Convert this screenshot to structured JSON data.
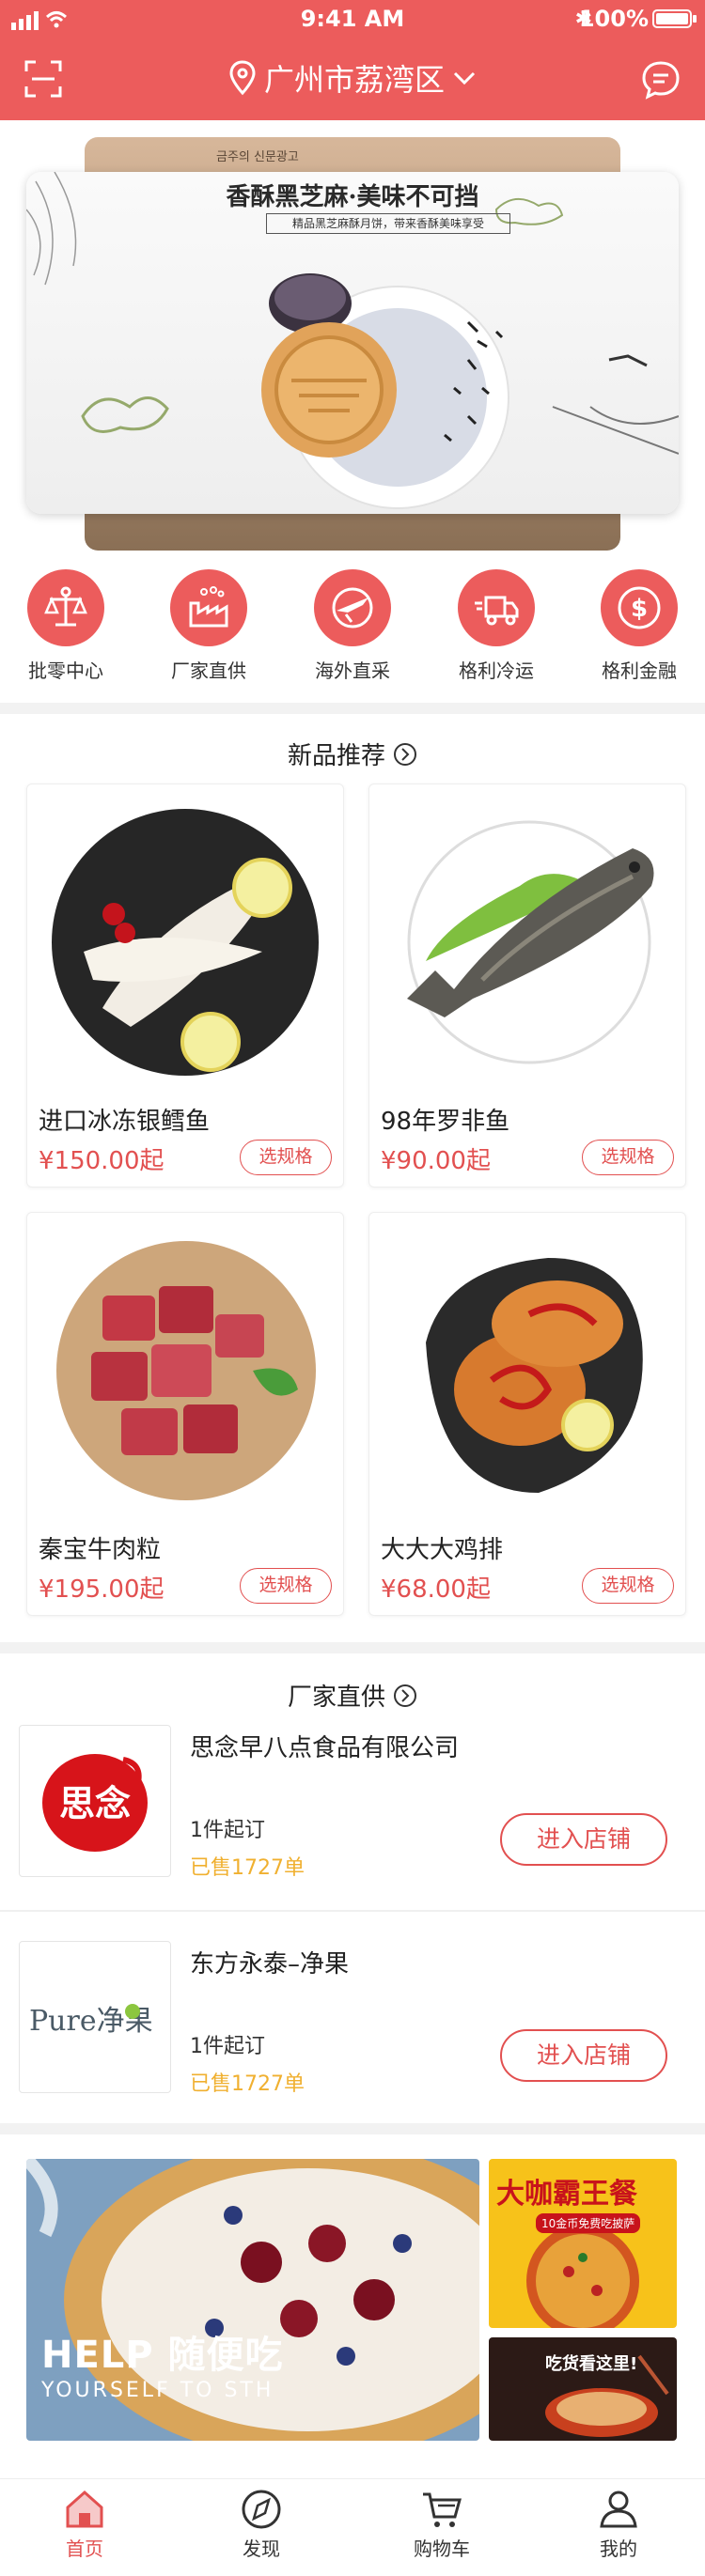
{
  "status_bar": {
    "time": "9:41 AM",
    "battery": "100%"
  },
  "header": {
    "location": "广州市荔湾区"
  },
  "banner": {
    "back_caption": "금주의 신문광고",
    "title": "香酥黑芝麻·美味不可挡",
    "subtitle": "精品黑芝麻酥月饼，带来香酥美味享受"
  },
  "categories": [
    {
      "label": "批零中心",
      "icon": "scale-icon"
    },
    {
      "label": "厂家直供",
      "icon": "factory-icon"
    },
    {
      "label": "海外直采",
      "icon": "plane-icon"
    },
    {
      "label": "格利冷运",
      "icon": "truck-icon"
    },
    {
      "label": "格利金融",
      "icon": "dollar-icon"
    }
  ],
  "new_products": {
    "title": "新品推荐",
    "spec_label": "选规格",
    "items": [
      {
        "name": "进口冰冻银鳕鱼",
        "price": "¥150.00起"
      },
      {
        "name": "98年罗非鱼",
        "price": "¥90.00起"
      },
      {
        "name": "秦宝牛肉粒",
        "price": "¥195.00起"
      },
      {
        "name": "大大大鸡排",
        "price": "¥68.00起"
      }
    ]
  },
  "factory": {
    "title": "厂家直供",
    "enter_label": "进入店铺",
    "shops": [
      {
        "name": "思念早八点食品有限公司",
        "min_order": "1件起订",
        "sold": "已售1727单",
        "logo_text": "思念"
      },
      {
        "name": "东方永泰–净果",
        "min_order": "1件起订",
        "sold": "已售1727单",
        "logo_text": "Pure净果"
      }
    ]
  },
  "promos": {
    "big_line1": "HELP 随便吃",
    "big_line2": "YOURSELF TO STH",
    "small1_title": "大咖霸王餐",
    "small1_sub": "10金币免费吃披萨",
    "small2_title": "吃货看这里!"
  },
  "tabbar": [
    {
      "label": "首页",
      "icon": "home-icon",
      "active": true
    },
    {
      "label": "发现",
      "icon": "compass-icon",
      "active": false
    },
    {
      "label": "购物车",
      "icon": "cart-icon",
      "active": false
    },
    {
      "label": "我的",
      "icon": "profile-icon",
      "active": false
    }
  ],
  "colors": {
    "brand_red": "#ec5c5c",
    "price_red": "#e25050",
    "sold_yellow": "#f0b030"
  }
}
